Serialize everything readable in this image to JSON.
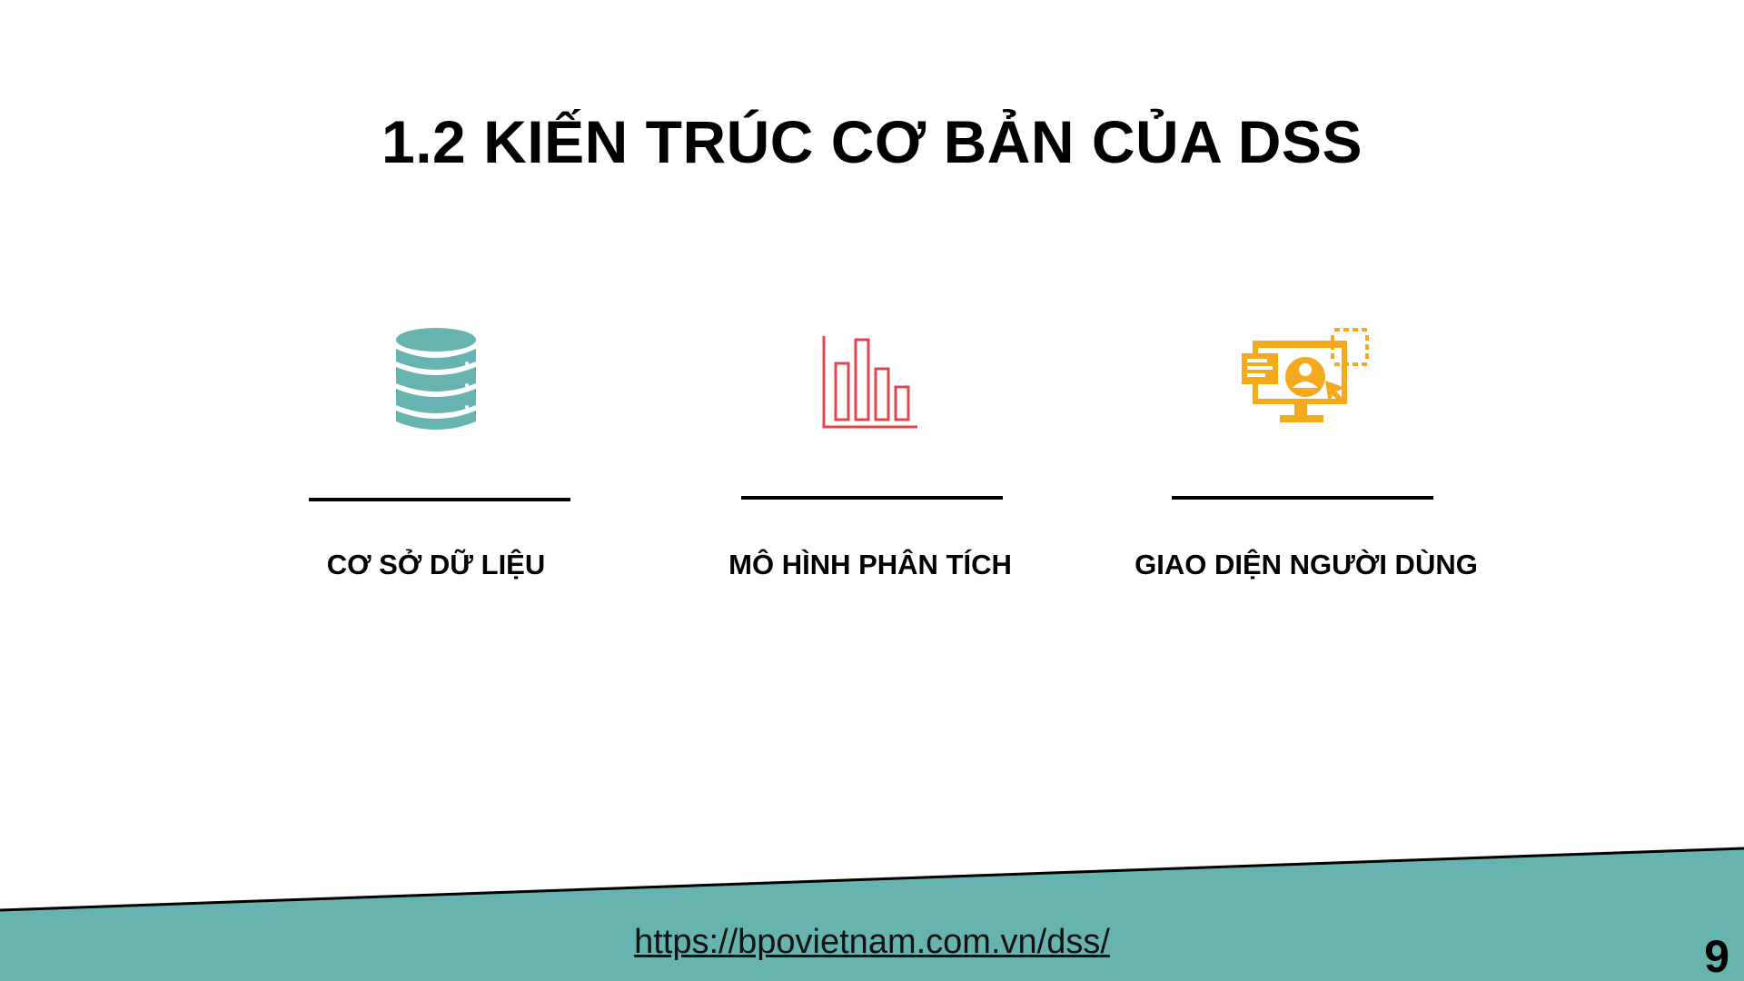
{
  "slide": {
    "title": "1.2 KIẾN TRÚC CƠ BẢN CỦA DSS",
    "items": [
      {
        "label": "CƠ SỞ DỮ LIỆU",
        "icon": "database-icon",
        "color": "#67b3b0"
      },
      {
        "label": "MÔ HÌNH PHÂN TÍCH",
        "icon": "bar-chart-icon",
        "color": "#e0474c"
      },
      {
        "label": "GIAO DIỆN NGƯỜI DÙNG",
        "icon": "user-interface-monitor-icon",
        "color": "#f5a91c"
      }
    ],
    "footer": {
      "url": "https://bpovietnam.com.vn/dss/",
      "band_color": "#67b3b0"
    },
    "page_number": "9"
  }
}
